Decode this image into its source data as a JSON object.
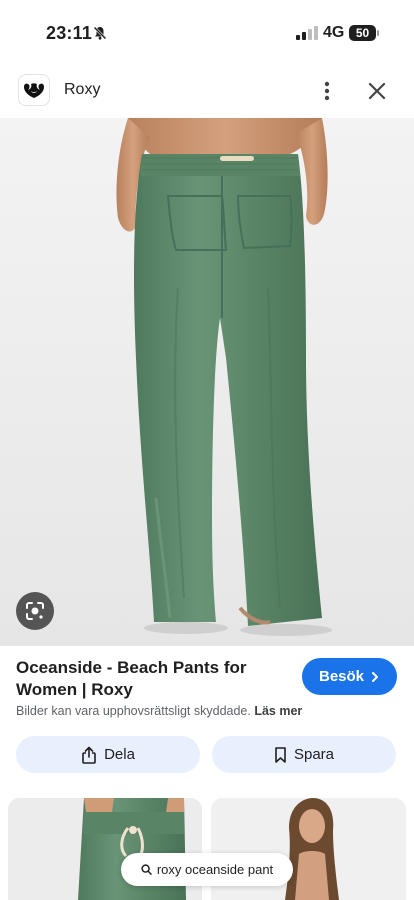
{
  "status_bar": {
    "time": "23:11",
    "network": "4G",
    "battery": "50"
  },
  "header": {
    "site_name": "Roxy"
  },
  "result": {
    "title": "Oceanside - Beach Pants for Women | Roxy",
    "visit_label": "Besök",
    "copyright_text": "Bilder kan vara upphovsrättsligt skyddade.",
    "read_more": "Läs mer"
  },
  "actions": {
    "share_label": "Dela",
    "save_label": "Spara"
  },
  "search_chip": {
    "query": "roxy oceanside pant"
  },
  "colors": {
    "accent": "#1a73e8",
    "chip_bg": "#e8f0fe",
    "pants_green": "#5f8a6c"
  },
  "icons": [
    "bell-slash-icon",
    "signal-icon",
    "battery-icon",
    "roxy-logo-icon",
    "more-vert-icon",
    "close-icon",
    "lens-icon",
    "chevron-right-icon",
    "share-icon",
    "bookmark-icon",
    "search-icon"
  ]
}
